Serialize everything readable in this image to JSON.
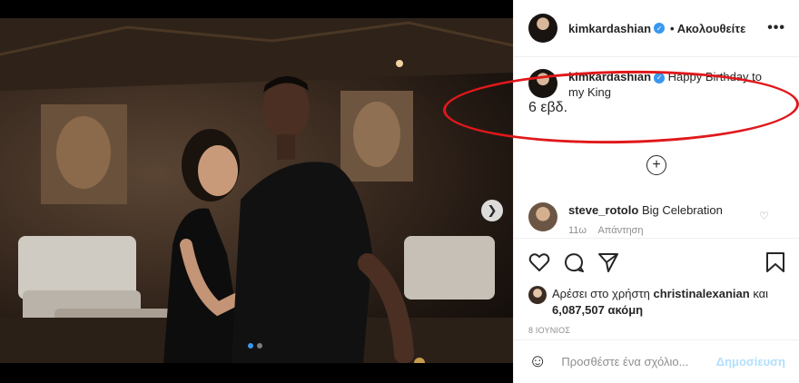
{
  "post": {
    "username": "kimkardashian",
    "follow_status": "• Ακολουθείτε",
    "more": "•••"
  },
  "caption": {
    "username": "kimkardashian",
    "text": "Happy Birthday to my King",
    "time": "6 εβδ."
  },
  "comments": [
    {
      "username": "steve_rotolo",
      "text": "Big Celebration",
      "time": "11ω",
      "reply": "Απάντηση"
    }
  ],
  "likes": {
    "prefix": "Αρέσει στο χρήστη",
    "user": "christinalexanian",
    "connector": "και",
    "count": "6,087,507",
    "suffix": "ακόμη"
  },
  "date": "8 ΙΟΥΝΙΟΣ",
  "add_comment": {
    "placeholder": "Προσθέστε ένα σχόλιο...",
    "post_label": "Δημοσίευση"
  },
  "carousel": {
    "count": 2,
    "active": 0
  },
  "colors": {
    "verified": "#3897f0",
    "highlight": "#e0181b",
    "post_button": "#b2dffc",
    "muted": "#8e8e8e"
  },
  "icons": [
    "verified-icon",
    "more-icon",
    "plus-circle-icon",
    "heart-icon",
    "comment-icon",
    "share-icon",
    "bookmark-icon",
    "emoji-icon",
    "chevron-right-icon"
  ]
}
